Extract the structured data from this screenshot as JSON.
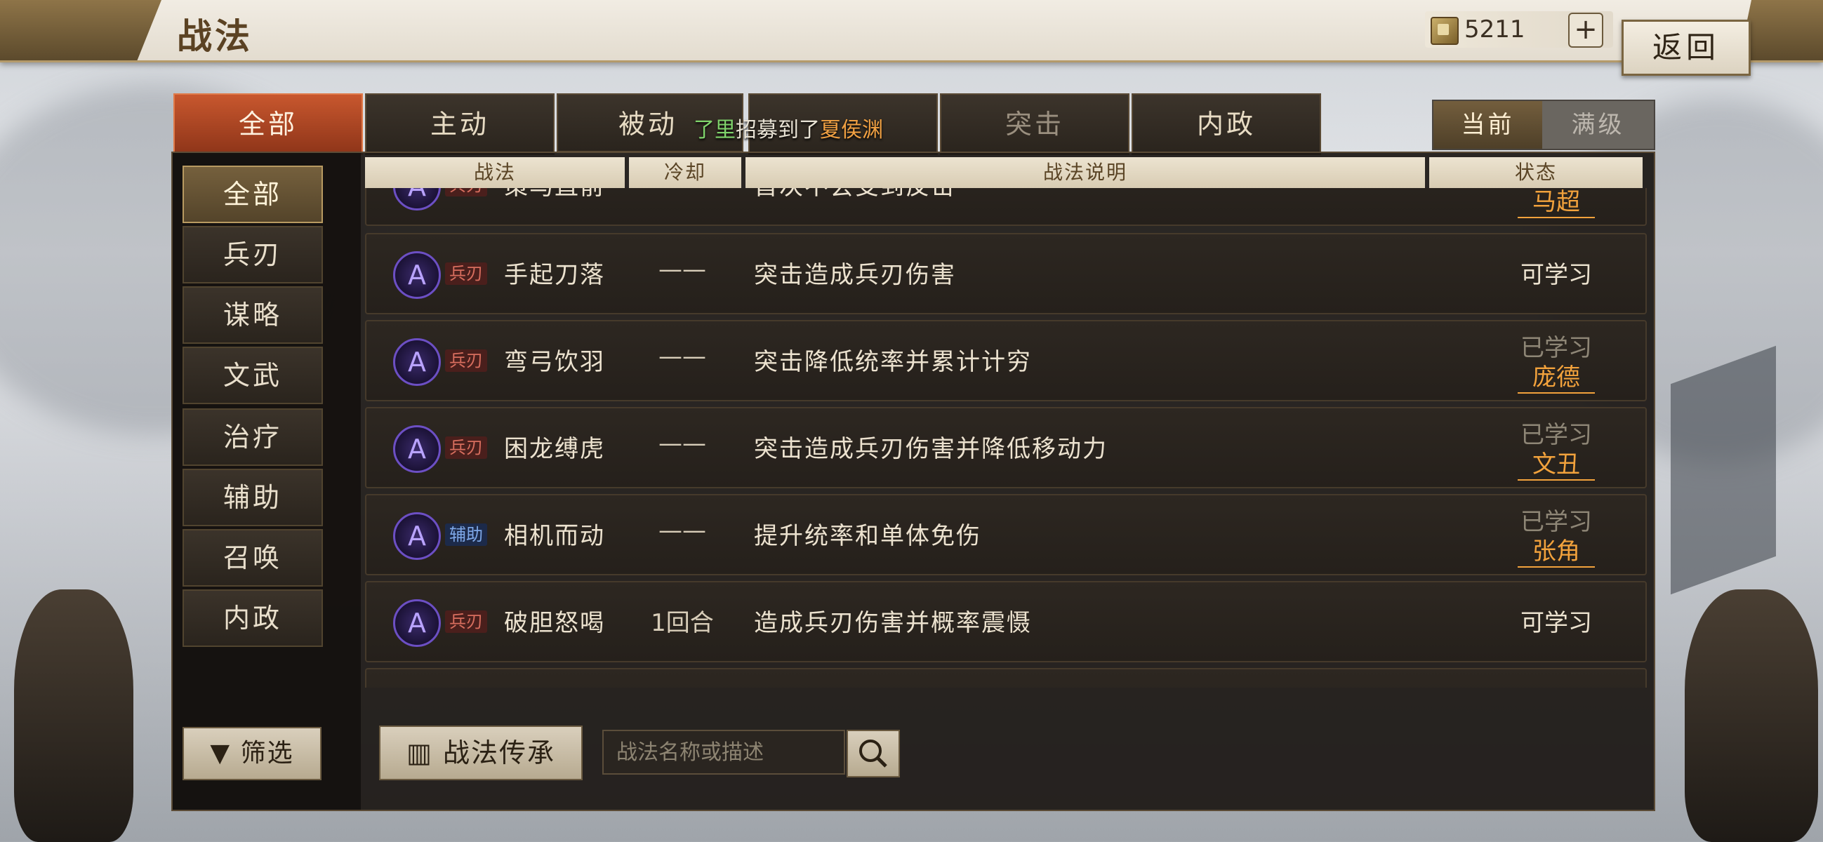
{
  "page": {
    "title": "战法",
    "back_label": "返回"
  },
  "currency": {
    "icon": "gold-token-icon",
    "value": "5211",
    "plus_label": "+"
  },
  "tabs": [
    {
      "label": "全部",
      "active": true
    },
    {
      "label": "主动"
    },
    {
      "label": "被动"
    },
    {
      "label": ""
    },
    {
      "label": "突击"
    },
    {
      "label": "内政"
    }
  ],
  "notice": {
    "prefix": "了里",
    "middle": "招募到了",
    "name": "夏侯渊"
  },
  "toggle": {
    "current": "当前",
    "max": "满级"
  },
  "sidebar": {
    "items": [
      "全部",
      "兵刃",
      "谋略",
      "文武",
      "治疗",
      "辅助",
      "召唤",
      "内政"
    ],
    "filter_label": "筛选"
  },
  "table": {
    "headers": [
      "战法",
      "冷却",
      "战法说明",
      "状态"
    ],
    "partial_top": {
      "tag": "兵刃",
      "name": "策马直前",
      "desc": "首次不会受到反击",
      "general": "马超"
    },
    "rows": [
      {
        "tag": "兵刃",
        "tag_type": "blade",
        "name": "手起刀落",
        "cooldown": "——",
        "desc": "突击造成兵刃伤害",
        "status": "可学习",
        "general": ""
      },
      {
        "tag": "兵刃",
        "tag_type": "blade",
        "name": "弯弓饮羽",
        "cooldown": "——",
        "desc": "突击降低统率并累计计穷",
        "status": "已学习",
        "general": "庞德"
      },
      {
        "tag": "兵刃",
        "tag_type": "blade",
        "name": "困龙缚虎",
        "cooldown": "——",
        "desc": "突击造成兵刃伤害并降低移动力",
        "status": "已学习",
        "general": "文丑"
      },
      {
        "tag": "辅助",
        "tag_type": "aux",
        "name": "相机而动",
        "cooldown": "——",
        "desc": "提升统率和单体免伤",
        "status": "已学习",
        "general": "张角"
      },
      {
        "tag": "兵刃",
        "tag_type": "blade",
        "name": "破胆怒喝",
        "cooldown": "1回合",
        "desc": "造成兵刃伤害并概率震慑",
        "status": "可学习",
        "general": ""
      }
    ],
    "skill_icon_letter": "A"
  },
  "bottom": {
    "inherit_label": "战法传承",
    "search_placeholder": "战法名称或描述"
  }
}
